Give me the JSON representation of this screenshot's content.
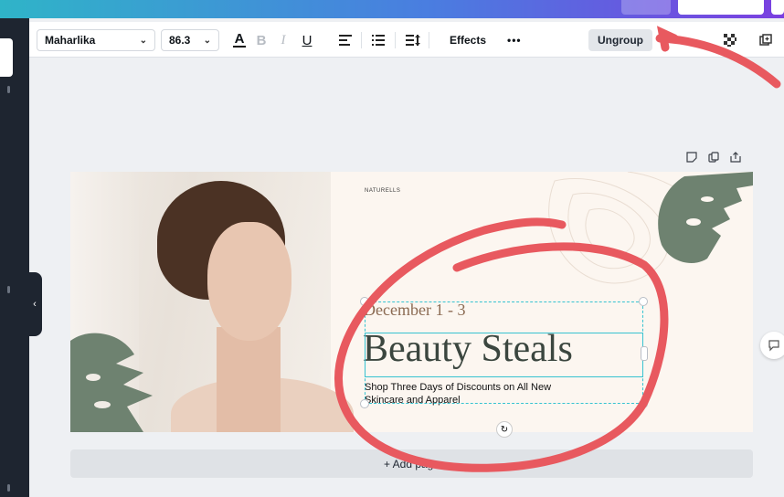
{
  "toolbar": {
    "font_name": "Maharlika",
    "font_size": "86.3",
    "color_letter": "A",
    "bold_letter": "B",
    "italic_letter": "I",
    "underline_letter": "U",
    "effects_label": "Effects",
    "more_label": "•••",
    "ungroup_label": "Ungroup"
  },
  "design": {
    "brand": "NATURELLS",
    "date": "December 1 - 3",
    "headline": "Beauty Steals",
    "subtext": "Shop Three Days of Discounts on All New Skincare and Apparel"
  },
  "add_page_label": "+ Add page",
  "colors": {
    "selection": "#37c3d1",
    "annotation": "#e8595f",
    "leaf": "#6e8270",
    "headline": "#3b463f",
    "date": "#8b6a52"
  },
  "icons": [
    "chevron-down-icon",
    "text-color-icon",
    "align-left-icon",
    "list-icon",
    "line-spacing-icon",
    "transparency-icon",
    "duplicate-icon",
    "note-icon",
    "copy-icon",
    "share-icon",
    "rotate-icon",
    "comment-icon"
  ]
}
